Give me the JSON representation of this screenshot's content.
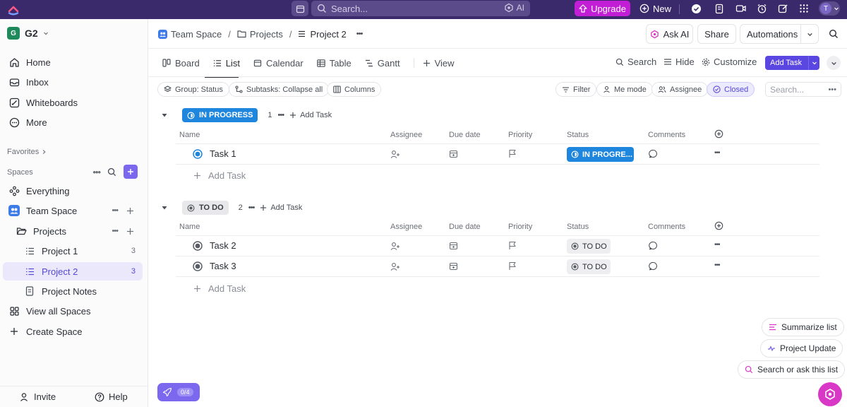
{
  "topbar": {
    "search_placeholder": "Search...",
    "ai_label": "AI",
    "upgrade_label": "Upgrade",
    "new_label": "New",
    "avatar_initial": "T"
  },
  "sidebar": {
    "workspace_badge": "G",
    "workspace_name": "G2",
    "nav": [
      "Home",
      "Inbox",
      "Whiteboards",
      "More"
    ],
    "favorites_label": "Favorites",
    "spaces_label": "Spaces",
    "everything_label": "Everything",
    "team_space_label": "Team Space",
    "projects_label": "Projects",
    "project1_label": "Project 1",
    "project1_count": "3",
    "project2_label": "Project 2",
    "project2_count": "3",
    "project_notes_label": "Project Notes",
    "view_all_spaces_label": "View all Spaces",
    "create_space_label": "Create Space",
    "invite_label": "Invite",
    "help_label": "Help"
  },
  "header": {
    "breadcrumb": [
      "Team Space",
      "Projects",
      "Project 2"
    ],
    "ask_ai_label": "Ask AI",
    "share_label": "Share",
    "automations_label": "Automations"
  },
  "views": {
    "tabs": [
      "Board",
      "List",
      "Calendar",
      "Table",
      "Gantt"
    ],
    "add_view_label": "View",
    "search_label": "Search",
    "hide_label": "Hide",
    "customize_label": "Customize",
    "add_task_label": "Add Task"
  },
  "filters": {
    "group_label": "Group: Status",
    "subtasks_label": "Subtasks: Collapse all",
    "columns_label": "Columns",
    "filter_label": "Filter",
    "me_mode_label": "Me mode",
    "assignee_label": "Assignee",
    "closed_label": "Closed",
    "search_placeholder": "Search..."
  },
  "columns": [
    "Name",
    "Assignee",
    "Due date",
    "Priority",
    "Status",
    "Comments"
  ],
  "groups": [
    {
      "status": "IN PROGRESS",
      "count": "1",
      "add_task_label": "Add Task",
      "tasks": [
        {
          "name": "Task 1",
          "status": "IN PROGRE..."
        }
      ]
    },
    {
      "status": "TO DO",
      "count": "2",
      "add_task_label": "Add Task",
      "tasks": [
        {
          "name": "Task 2",
          "status": "TO DO"
        },
        {
          "name": "Task 3",
          "status": "TO DO"
        }
      ]
    }
  ],
  "add_task_row_label": "Add Task",
  "floating": {
    "summarize_label": "Summarize list",
    "project_update_label": "Project Update",
    "search_ask_label": "Search or ask this list",
    "progress_label": "0/4"
  },
  "colors": {
    "topbar_bg": "#3b2a6b",
    "accent": "#7b68ee",
    "in_progress": "#1f86de",
    "upgrade": "#c21ed6"
  }
}
